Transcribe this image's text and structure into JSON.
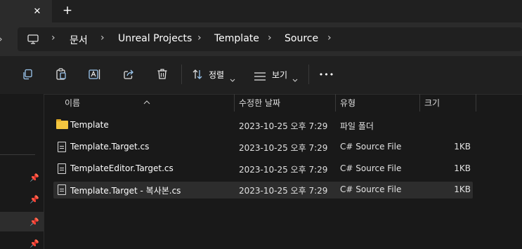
{
  "tabbar": {
    "close_glyph": "✕",
    "new_tab_glyph": "+"
  },
  "address": {
    "device_icon": "monitor-icon",
    "crumbs": [
      "문서",
      "Unreal Projects",
      "Template",
      "Source"
    ],
    "separator": "›"
  },
  "toolbar": {
    "icons": [
      "copy-icon",
      "paste-icon",
      "rename-icon",
      "share-icon",
      "delete-icon"
    ],
    "sort_label": "정렬",
    "view_label": "보기",
    "more_glyph": "•••"
  },
  "columns": {
    "name": "이름",
    "modified": "수정한 날짜",
    "type": "유형",
    "size": "크기"
  },
  "files": [
    {
      "name": "Template",
      "modified": "2023-10-25 오후 7:29",
      "type": "파일 폴더",
      "size": "",
      "icon": "folder-icon",
      "selected": false
    },
    {
      "name": "Template.Target.cs",
      "modified": "2023-10-25 오후 7:29",
      "type": "C# Source File",
      "size": "1KB",
      "icon": "file-icon",
      "selected": false
    },
    {
      "name": "TemplateEditor.Target.cs",
      "modified": "2023-10-25 오후 7:29",
      "type": "C# Source File",
      "size": "1KB",
      "icon": "file-icon",
      "selected": false
    },
    {
      "name": "Template.Target - 복사본.cs",
      "modified": "2023-10-25 오후 7:29",
      "type": "C# Source File",
      "size": "1KB",
      "icon": "file-icon",
      "selected": true
    }
  ],
  "colors": {
    "accent_icon": "#9bc6ee",
    "folder": "#f3c640",
    "selection": "#2d2d2d"
  }
}
